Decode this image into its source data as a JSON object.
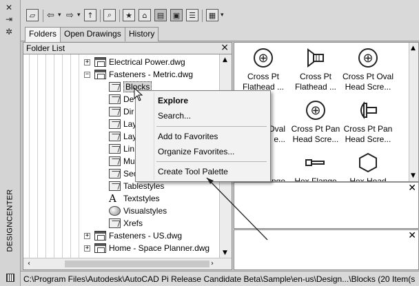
{
  "palette": {
    "title": "DESIGNCENTER"
  },
  "tabs": [
    {
      "label": "Folders",
      "active": true
    },
    {
      "label": "Open Drawings",
      "active": false
    },
    {
      "label": "History",
      "active": false
    }
  ],
  "folder_list": {
    "title": "Folder List",
    "close_label": "×",
    "items": [
      {
        "label": "Electrical Power.dwg"
      },
      {
        "label": "Fasteners - Metric.dwg"
      },
      {
        "label": "Blocks"
      },
      {
        "label": "De"
      },
      {
        "label": "Dir"
      },
      {
        "label": "Lay"
      },
      {
        "label": "Lay"
      },
      {
        "label": "Lin"
      },
      {
        "label": "Mu"
      },
      {
        "label": "Sec"
      },
      {
        "label": "Tablestyles"
      },
      {
        "label": "Textstyles"
      },
      {
        "label": "Visualstyles"
      },
      {
        "label": "Xrefs"
      },
      {
        "label": "Fasteners - US.dwg"
      },
      {
        "label": "Home - Space Planner.dwg"
      }
    ]
  },
  "content": {
    "items": [
      {
        "line1": "Cross Pt",
        "line2": "Flathead ...",
        "icon": "cross-circle-icon"
      },
      {
        "line1": "Cross Pt",
        "line2": "Flathead ...",
        "icon": "flathead-side-icon"
      },
      {
        "line1": "Cross Pt Oval",
        "line2": "Head Scre...",
        "icon": "cross-circle-icon"
      },
      {
        "line1": "Oval",
        "line2": "e...",
        "icon": ""
      },
      {
        "line1": "Cross Pt Pan",
        "line2": "Head Scre...",
        "icon": "cross-circle-icon"
      },
      {
        "line1": "Cross Pt Pan",
        "line2": "Head Scre...",
        "icon": "pan-side-icon"
      },
      {
        "line1": "nge",
        "line2": "",
        "icon": ""
      },
      {
        "line1": "Hex Flange",
        "line2": "",
        "icon": "hex-flange-side-icon"
      },
      {
        "line1": "Hex Head",
        "line2": "",
        "icon": "hexagon-icon"
      }
    ]
  },
  "context_menu": {
    "items": [
      {
        "label": "Explore",
        "bold": true
      },
      {
        "label": "Search...",
        "bold": false
      },
      {
        "label": "Add to Favorites",
        "bold": false
      },
      {
        "label": "Organize Favorites...",
        "bold": false
      },
      {
        "label": "Create Tool Palette",
        "bold": false
      }
    ]
  },
  "status_bar": {
    "path": "C:\\Program Files\\Autodesk\\AutoCAD Pi Release Candidate Beta\\Sample\\en-us\\Design...\\Blocks (20 Item(s"
  },
  "colors": {
    "pane_background": "#ffffff",
    "chrome_background": "#d9d9d9"
  }
}
